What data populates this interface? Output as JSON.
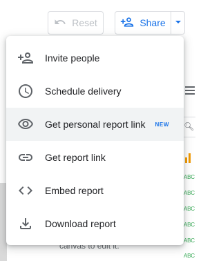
{
  "toolbar": {
    "reset_label": "Reset",
    "share_label": "Share"
  },
  "menu": {
    "items": [
      {
        "label": "Invite people",
        "icon": "person-add-icon"
      },
      {
        "label": "Schedule delivery",
        "icon": "clock-icon"
      },
      {
        "label": "Get personal report link",
        "icon": "eye-icon",
        "badge": "NEW",
        "highlighted": true
      },
      {
        "label": "Get report link",
        "icon": "link-icon"
      },
      {
        "label": "Embed report",
        "icon": "code-icon"
      },
      {
        "label": "Download report",
        "icon": "download-icon"
      }
    ]
  },
  "background": {
    "hint_text": "canvas to edit it.",
    "field_type_label": "ABC"
  },
  "colors": {
    "accent": "#1a73e8",
    "text": "#202124",
    "icon": "#5f6368",
    "highlight": "#f1f3f4",
    "field_green": "#34a853"
  }
}
